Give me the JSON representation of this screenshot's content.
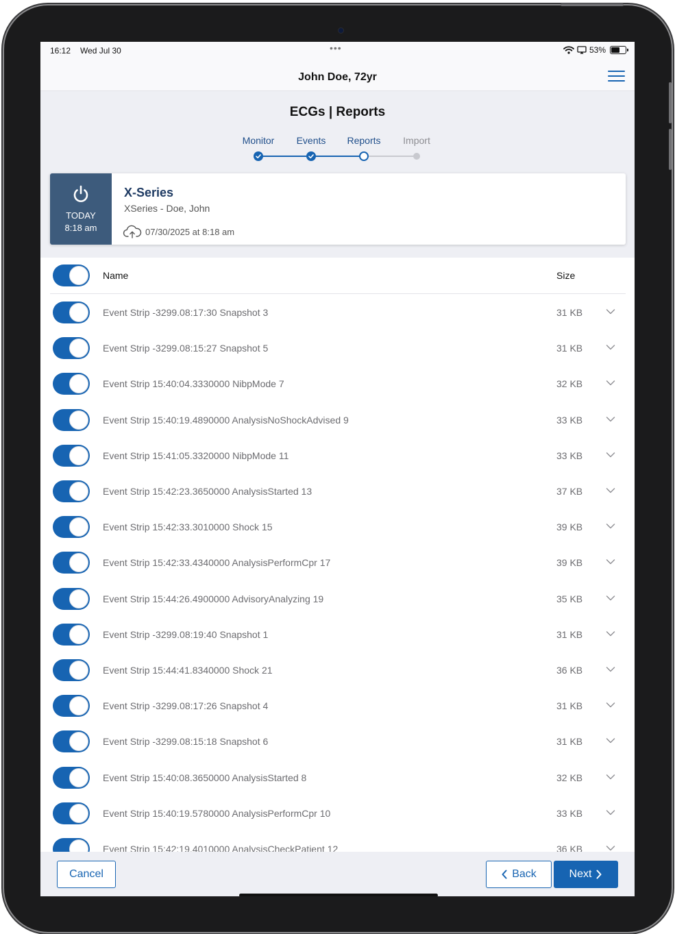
{
  "status_bar": {
    "time": "16:12",
    "date": "Wed Jul 30",
    "battery": "53%",
    "battery_level": 0.53
  },
  "nav": {
    "title": "John Doe, 72yr",
    "menu_icon": "hamburger-menu-icon"
  },
  "page": {
    "title": "ECGs | Reports"
  },
  "stepper": {
    "steps": [
      {
        "label": "Monitor",
        "state": "done"
      },
      {
        "label": "Events",
        "state": "done"
      },
      {
        "label": "Reports",
        "state": "current"
      },
      {
        "label": "Import",
        "state": "future"
      }
    ]
  },
  "device_card": {
    "day": "TODAY",
    "time": "8:18 am",
    "name": "X-Series",
    "subtitle": "XSeries - Doe, John",
    "uploaded": "07/30/2025 at 8:18 am"
  },
  "list": {
    "header_name": "Name",
    "header_size": "Size",
    "all_selected": true,
    "rows": [
      {
        "name": "Event Strip -3299.08:17:30 Snapshot 3",
        "size": "31 KB",
        "selected": true
      },
      {
        "name": "Event Strip -3299.08:15:27 Snapshot 5",
        "size": "31 KB",
        "selected": true
      },
      {
        "name": "Event Strip 15:40:04.3330000 NibpMode 7",
        "size": "32 KB",
        "selected": true
      },
      {
        "name": "Event Strip 15:40:19.4890000 AnalysisNoShockAdvised 9",
        "size": "33 KB",
        "selected": true
      },
      {
        "name": "Event Strip 15:41:05.3320000 NibpMode 11",
        "size": "33 KB",
        "selected": true
      },
      {
        "name": "Event Strip 15:42:23.3650000 AnalysisStarted 13",
        "size": "37 KB",
        "selected": true
      },
      {
        "name": "Event Strip 15:42:33.3010000 Shock 15",
        "size": "39 KB",
        "selected": true
      },
      {
        "name": "Event Strip 15:42:33.4340000 AnalysisPerformCpr 17",
        "size": "39 KB",
        "selected": true
      },
      {
        "name": "Event Strip 15:44:26.4900000 AdvisoryAnalyzing 19",
        "size": "35 KB",
        "selected": true
      },
      {
        "name": "Event Strip -3299.08:19:40 Snapshot 1",
        "size": "31 KB",
        "selected": true
      },
      {
        "name": "Event Strip 15:44:41.8340000 Shock 21",
        "size": "36 KB",
        "selected": true
      },
      {
        "name": "Event Strip -3299.08:17:26 Snapshot 4",
        "size": "31 KB",
        "selected": true
      },
      {
        "name": "Event Strip -3299.08:15:18 Snapshot 6",
        "size": "31 KB",
        "selected": true
      },
      {
        "name": "Event Strip 15:40:08.3650000 AnalysisStarted 8",
        "size": "32 KB",
        "selected": true
      },
      {
        "name": "Event Strip 15:40:19.5780000 AnalysisPerformCpr 10",
        "size": "33 KB",
        "selected": true
      },
      {
        "name": "Event Strip 15:42:19.4010000 AnalysisCheckPatient 12",
        "size": "36 KB",
        "selected": true
      }
    ]
  },
  "footer": {
    "cancel": "Cancel",
    "back": "Back",
    "next": "Next"
  },
  "colors": {
    "accent": "#1764b2",
    "card_side": "#3d5b7c",
    "title_text": "#1f3b63",
    "header_bg": "#eeeff4"
  }
}
